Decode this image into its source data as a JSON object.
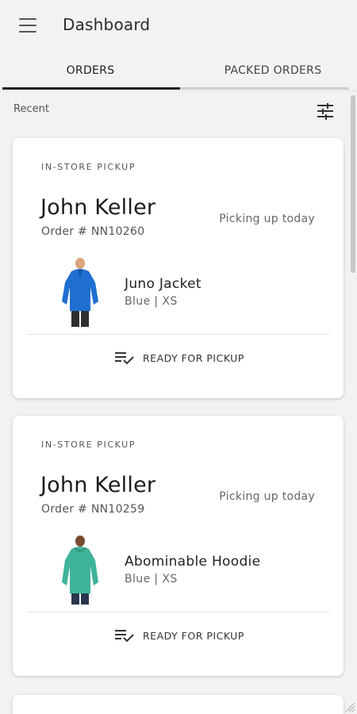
{
  "app": {
    "title": "Dashboard",
    "menu_icon": "menu-icon"
  },
  "tabs": [
    {
      "label": "ORDERS",
      "selected": true
    },
    {
      "label": "PACKED ORDERS",
      "selected": false
    }
  ],
  "section": {
    "label": "Recent",
    "filter_icon": "tune-icon"
  },
  "orders": [
    {
      "kind": "IN-STORE PICKUP",
      "customer": "John Keller",
      "order_number": "Order # NN10260",
      "status": "Picking up today",
      "product": {
        "name": "Juno Jacket",
        "variant": "Blue | XS",
        "image_color": "#1f6fd0"
      },
      "action": {
        "label": "READY FOR PICKUP",
        "icon": "checklist-icon"
      }
    },
    {
      "kind": "IN-STORE PICKUP",
      "customer": "John Keller",
      "order_number": "Order # NN10259",
      "status": "Picking up today",
      "product": {
        "name": "Abominable Hoodie",
        "variant": "Blue | XS",
        "image_color": "#3fb39a"
      },
      "action": {
        "label": "READY FOR PICKUP",
        "icon": "checklist-icon"
      }
    }
  ],
  "colors": {
    "background": "#f2f2f2",
    "card": "#ffffff",
    "tab_indicator": "#1f1f1f"
  }
}
